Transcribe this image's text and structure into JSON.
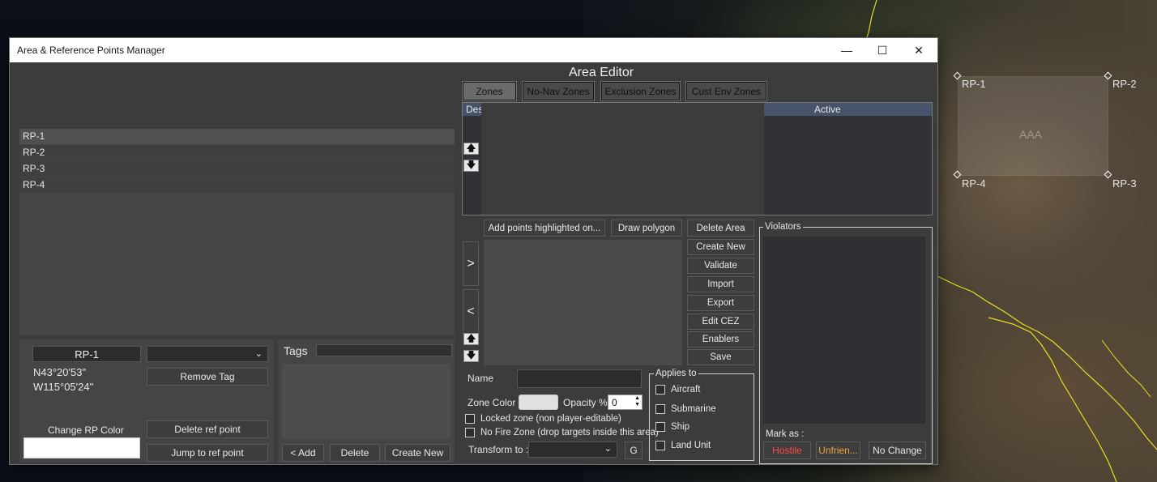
{
  "map": {
    "zone_label": "AAA",
    "ref_points": [
      "RP-1",
      "RP-2",
      "RP-3",
      "RP-4"
    ]
  },
  "window": {
    "title": "Area & Reference Points Manager",
    "controls": {
      "minimize": "—",
      "maximize": "☐",
      "close": "✕"
    }
  },
  "rp_manager": {
    "items": [
      "RP-1",
      "RP-2",
      "RP-3",
      "RP-4"
    ],
    "selected": {
      "name": "RP-1",
      "lat": "N43°20'53\"",
      "lon": "W115°05'24\"",
      "tag_dropdown": ""
    },
    "buttons": {
      "remove_tag": "Remove Tag",
      "change_color": "Change RP Color",
      "delete_ref": "Delete ref point",
      "jump_ref": "Jump to ref point"
    },
    "tags": {
      "title": "Tags",
      "add": "< Add",
      "delete": "Delete",
      "create_new": "Create New"
    }
  },
  "area_editor": {
    "title": "Area Editor",
    "tabs": [
      "Zones",
      "No-Nav Zones",
      "Exclusion Zones",
      "Cust Env Zones"
    ],
    "table_headers": {
      "description": "Des",
      "active": "Active"
    },
    "buttons": {
      "add_points": "Add points highlighted on...",
      "draw_polygon": "Draw polygon",
      "delete_area": "Delete Area",
      "create_new": "Create New",
      "validate": "Validate",
      "import": "Import",
      "export": "Export",
      "edit_cez": "Edit CEZ",
      "enablers": "Enablers",
      "save": "Save",
      "move_right": ">",
      "move_left": "<",
      "g": "G"
    },
    "name_label": "Name",
    "name_value": "",
    "zone_color_label": "Zone Color",
    "opacity_label": "Opacity %",
    "opacity_value": "0",
    "locked_label": "Locked zone (non player-editable)",
    "nofire_label": "No Fire Zone (drop targets inside this area)",
    "transform_label": "Transform to :",
    "applies_to": {
      "title": "Applies to",
      "items": [
        "Aircraft",
        "Submarine",
        "Ship",
        "Land Unit"
      ]
    },
    "violators": {
      "title": "Violators",
      "mark_as": "Mark as :",
      "hostile": "Hostile",
      "unfriendly": "Unfrien...",
      "no_change": "No Change",
      "colors": {
        "hostile": "#ff4a4a",
        "unfriendly": "#e8a23a"
      }
    }
  }
}
